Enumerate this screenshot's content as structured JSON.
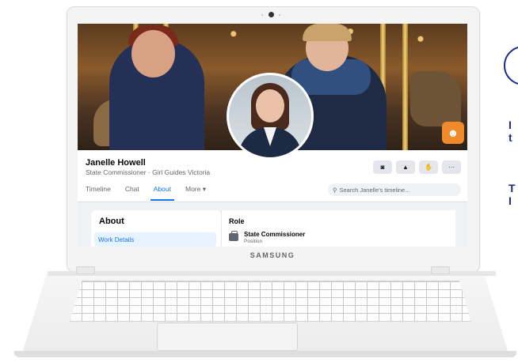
{
  "laptop": {
    "brand": "SAMSUNG"
  },
  "profile": {
    "name": "Janelle Howell",
    "subtitle": "State Commissioner · Girl Guides Victoria"
  },
  "actions": [
    {
      "icon": "messenger-icon",
      "glyph": "◙"
    },
    {
      "icon": "bell-icon",
      "glyph": "▲"
    },
    {
      "icon": "thumbs-up-icon",
      "glyph": "✋"
    },
    {
      "icon": "more-icon",
      "glyph": "···"
    }
  ],
  "tabs": [
    {
      "label": "Timeline",
      "active": false
    },
    {
      "label": "Chat",
      "active": false
    },
    {
      "label": "About",
      "active": true
    },
    {
      "label": "More ▾",
      "active": false
    }
  ],
  "search": {
    "placeholder": "Search Janelle's timeline..."
  },
  "about": {
    "title": "About",
    "selected_item": "Work Details"
  },
  "role": {
    "heading": "Role",
    "name": "State Commissioner",
    "label": "Position"
  },
  "colors": {
    "accent": "#1877f2",
    "navy": "#1a2d8a",
    "badge": "#f08a2b"
  },
  "side_text": {
    "line1": "I",
    "line2": "t",
    "line3": "T",
    "line4": "I"
  }
}
